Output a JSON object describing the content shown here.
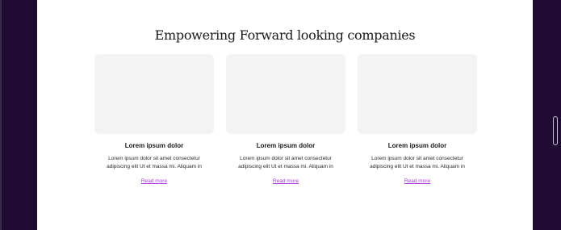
{
  "section": {
    "title": "Empowering Forward looking companies"
  },
  "cards": [
    {
      "title": "Lorem ipsum dolor",
      "text": "Lorem ipsum dolor sit amet consectetur adipiscing elit Ut et massa mi. Aliquam in",
      "link": "Read more"
    },
    {
      "title": "Lorem ipsum dolor",
      "text": "Lorem ipsum dolor sit amet consectetur adipiscing elit Ut et massa mi. Aliquam in",
      "link": "Read more"
    },
    {
      "title": "Lorem ipsum dolor",
      "text": "Lorem ipsum dolor sit amet consectetur adipiscing elit Ut et massa mi. Aliquam in",
      "link": "Read more"
    }
  ],
  "colors": {
    "background": "#200c33",
    "panel": "#ffffff",
    "image_placeholder": "#f3f3f3",
    "link": "#a63ad6"
  }
}
